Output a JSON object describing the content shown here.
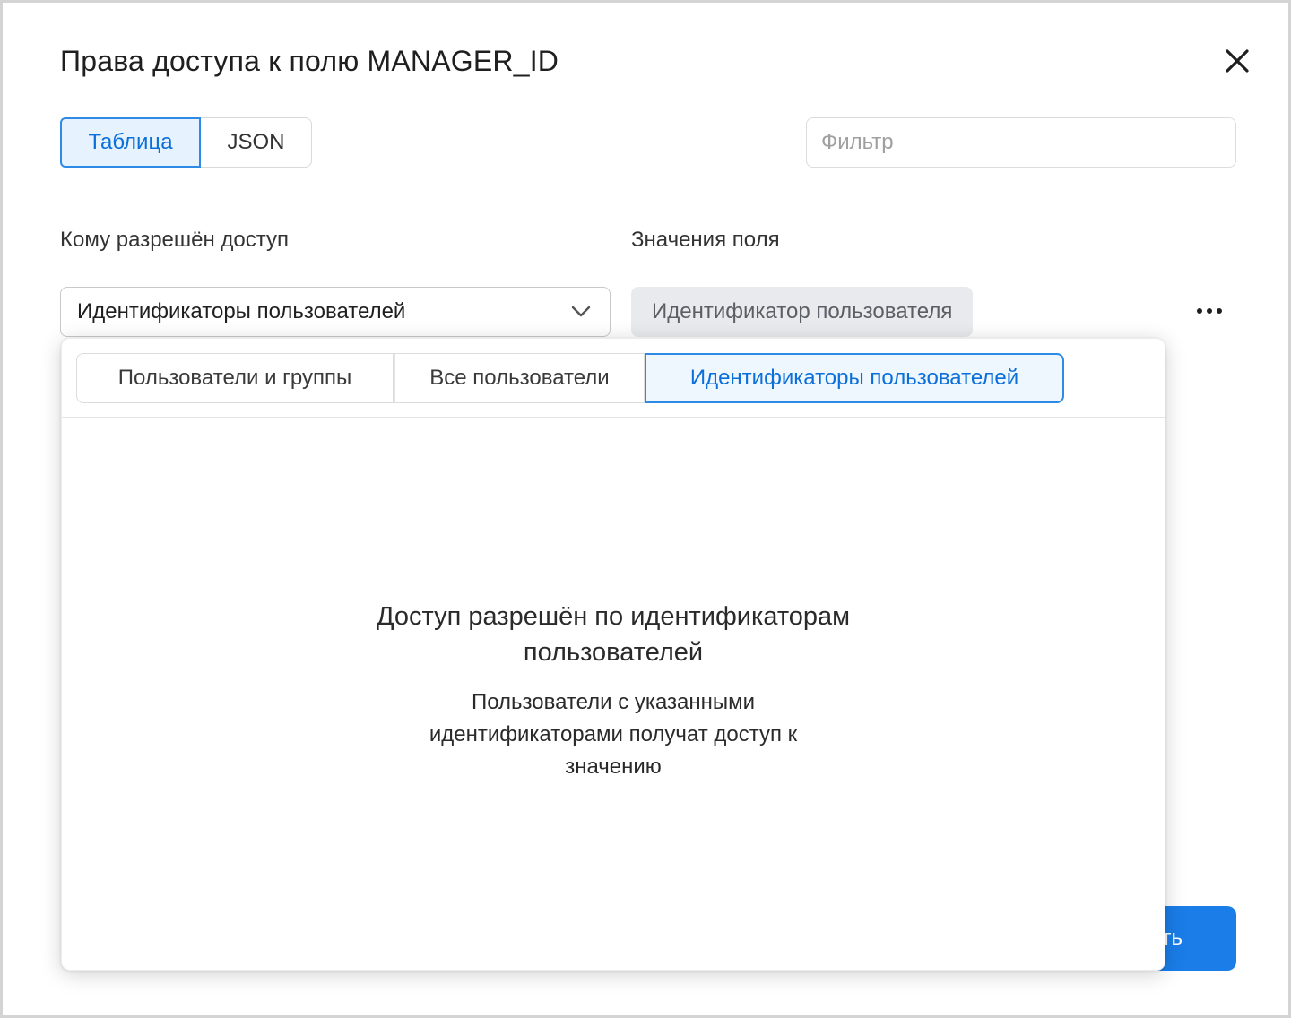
{
  "dialog": {
    "title": "Права доступа к полю MANAGER_ID"
  },
  "view_toggle": {
    "table_label": "Таблица",
    "json_label": "JSON",
    "active": "Таблица"
  },
  "filter": {
    "placeholder": "Фильтр",
    "value": ""
  },
  "columns": {
    "who_label": "Кому разрешён доступ",
    "values_label": "Значения поля"
  },
  "row": {
    "access_select_value": "Идентификаторы пользователей",
    "field_value_chip": "Идентификатор пользователя"
  },
  "popup": {
    "tabs": [
      {
        "label": "Пользователи и группы",
        "active": false
      },
      {
        "label": "Все пользователи",
        "active": false
      },
      {
        "label": "Идентификаторы пользователей",
        "active": true
      }
    ],
    "empty_title": "Доступ разрешён по идентификаторам пользователей",
    "empty_description": "Пользователи с указанными идентификаторами получат доступ к значению"
  },
  "footer": {
    "primary_button_visible_text": "ть"
  },
  "colors": {
    "accent": "#2f8ae6",
    "accent_text": "#0a6fd9",
    "primary_button": "#1a7de8",
    "chip_bg": "#e8eaed"
  }
}
